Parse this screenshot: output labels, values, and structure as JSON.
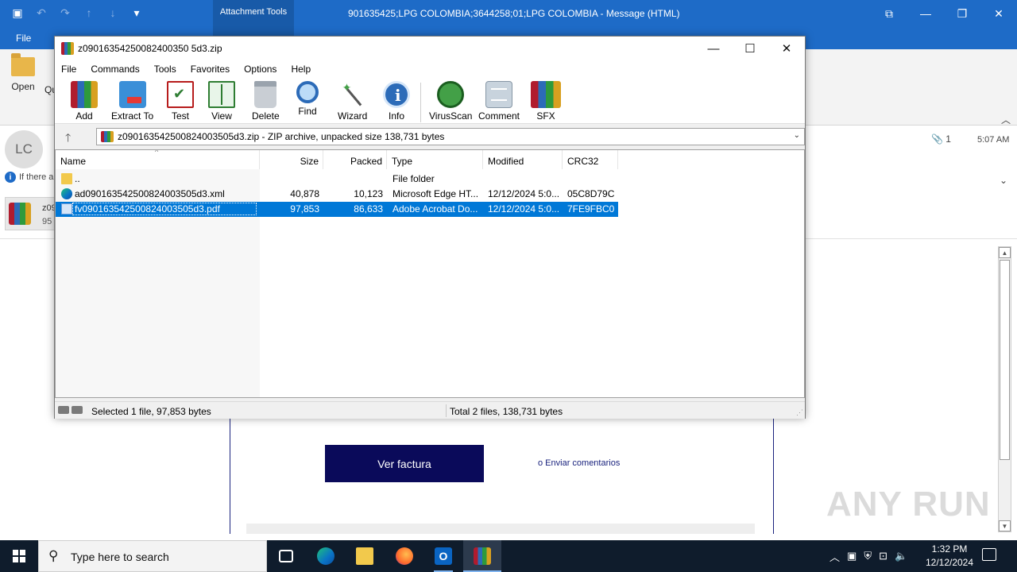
{
  "outlook": {
    "title": "901635425;LPG  COLOMBIA;3644258;01;LPG  COLOMBIA  -  Message (HTML)",
    "context_tab": "Attachment Tools",
    "file_tab": "File",
    "open_label": "Open",
    "quick_label": "Qu",
    "sender_initials": "LC",
    "info_text": "If there a",
    "attachment_count": "1",
    "time": "5:07 AM",
    "attachment_name": "z09",
    "attachment_size": "95",
    "body": {
      "button": "Ver factura",
      "feedback": "o Enviar comentarios"
    }
  },
  "winrar": {
    "title": "z09016354250082400350 5d3.zip",
    "menu": [
      "File",
      "Commands",
      "Tools",
      "Favorites",
      "Options",
      "Help"
    ],
    "toolbar": {
      "add": "Add",
      "extract": "Extract To",
      "test": "Test",
      "view": "View",
      "delete": "Delete",
      "find": "Find",
      "wizard": "Wizard",
      "info": "Info",
      "virusscan": "VirusScan",
      "comment": "Comment",
      "sfx": "SFX"
    },
    "address": "z090163542500824003505d3.zip - ZIP archive, unpacked size 138,731 bytes",
    "columns": {
      "name": "Name",
      "size": "Size",
      "packed": "Packed",
      "type": "Type",
      "modified": "Modified",
      "crc": "CRC32"
    },
    "files": [
      {
        "name": "..",
        "size": "",
        "packed": "",
        "type": "File folder",
        "modified": "",
        "crc": "",
        "icon": "folder-icon"
      },
      {
        "name": "ad090163542500824003505d3.xml",
        "size": "40,878",
        "packed": "10,123",
        "type": "Microsoft Edge HT...",
        "modified": "12/12/2024 5:0...",
        "crc": "05C8D79C",
        "icon": "edge-icon"
      },
      {
        "name": "fv090163542500824003505d3.pdf",
        "size": "97,853",
        "packed": "86,633",
        "type": "Adobe Acrobat Do...",
        "modified": "12/12/2024 5:0...",
        "crc": "7FE9FBC0",
        "icon": "pdf-icon",
        "selected": true
      }
    ],
    "status_left": "Selected 1 file, 97,853 bytes",
    "status_right": "Total 2 files, 138,731 bytes"
  },
  "taskbar": {
    "search_placeholder": "Type here to search",
    "time": "1:32 PM",
    "date": "12/12/2024"
  },
  "watermark": "ANY RUN",
  "colors": {
    "outlook_blue": "#1e6bc7",
    "selection": "#0078d7",
    "button_navy": "#0a0a5a",
    "taskbar": "#0f1c2c"
  }
}
